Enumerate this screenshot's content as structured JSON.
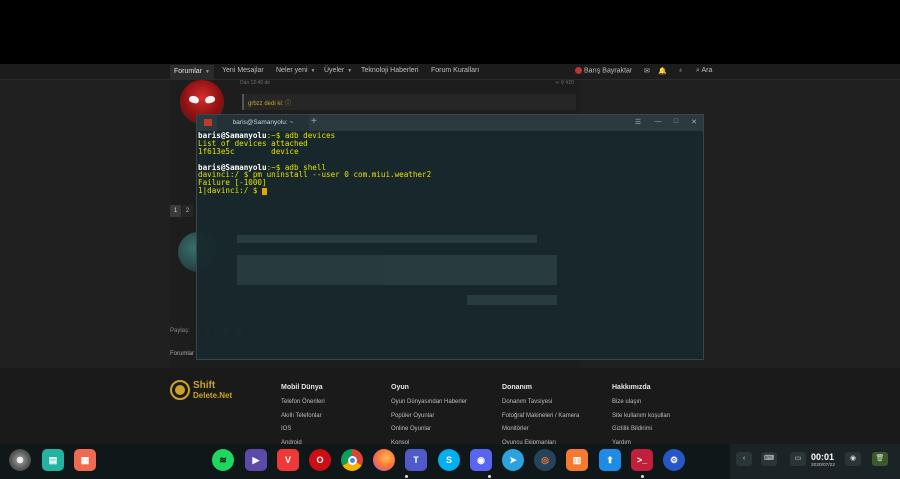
{
  "navbar": {
    "forums": "Forumlar",
    "new_messages": "Yeni Mesajlar",
    "whats_new": "Neler yeni",
    "members": "Üyeler",
    "tech_news": "Teknoloji Haberleri",
    "forum_rules": "Forum Kuralları",
    "user_name": "Barış Bayraktar",
    "search": "Ara"
  },
  "post": {
    "date": "Dün 12:49 de",
    "number": "#20",
    "quote_author": "grbzz dedi ki: ⓘ"
  },
  "pagination": [
    "1",
    "2"
  ],
  "share_label": "Paylaş:",
  "breadcrumb_forums": "Forumlar",
  "footer": {
    "logo_line1": "Shift",
    "logo_line2": "Delete.Net",
    "columns": [
      {
        "title": "Mobil Dünya",
        "links": [
          "Telefon Önerileri",
          "Akıllı Telefonlar",
          "IOS",
          "Android"
        ]
      },
      {
        "title": "Oyun",
        "links": [
          "Oyun Dünyasından Haberler",
          "Popüler Oyunlar",
          "Online Oyunlar",
          "Konsol"
        ]
      },
      {
        "title": "Donanım",
        "links": [
          "Donanım Tavsiyesi",
          "Fotoğraf Makineleri / Kamera",
          "Monitörler",
          "Oyuncu Ekipmanları"
        ]
      },
      {
        "title": "Hakkımızda",
        "links": [
          "Bize ulaşın",
          "Site kullanım koşulları",
          "Gizlilik Bildirimi",
          "Yardım"
        ]
      }
    ]
  },
  "terminal": {
    "tab_title": "baris@Samanyolu: ~",
    "lines": [
      {
        "user": "baris@Samanyolu",
        "rest": ":~$ adb devices"
      },
      {
        "text": "List of devices attached"
      },
      {
        "text": "1f613e5c        device"
      },
      {
        "text": ""
      },
      {
        "user": "baris@Samanyolu",
        "rest": ":~$ adb shell"
      },
      {
        "text": "davinci:/ $ pm uninstall --user 0 com.miui.weather2"
      },
      {
        "text": "Failure [-1000]"
      },
      {
        "text": "1|davinci:/ $ ",
        "cursor": true
      }
    ]
  },
  "taskbar": {
    "clock_time": "00:01",
    "clock_date": "2020/07/22",
    "apps": [
      "Spotify",
      "Kdenlive",
      "Vivaldi",
      "Opera",
      "Chrome",
      "Firefox",
      "Teams",
      "Skype",
      "Discord",
      "Telegram",
      "Blender",
      "Software Store",
      "App Store",
      "Terminal",
      "Settings"
    ]
  },
  "colors": {
    "terminal_bg": "#18282c",
    "prompt_text": "#e4e000",
    "accent_gold": "#c9a227",
    "taskbar_bg": "#0f1719"
  }
}
